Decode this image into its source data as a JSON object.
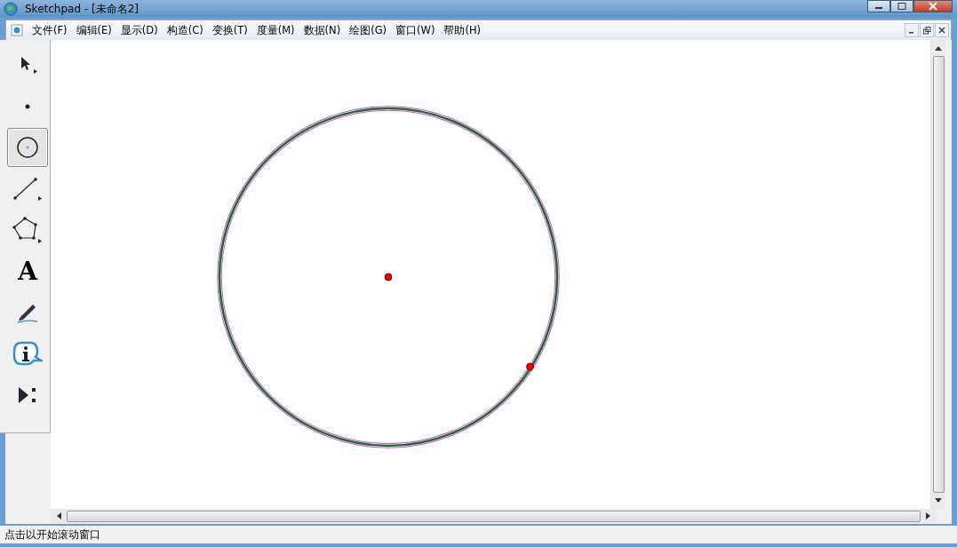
{
  "window": {
    "title": "Sketchpad  - [未命名2]"
  },
  "menu": [
    "文件(F)",
    "编辑(E)",
    "显示(D)",
    "构造(C)",
    "变换(T)",
    "度量(M)",
    "数据(N)",
    "绘图(G)",
    "窗口(W)",
    "帮助(H)"
  ],
  "tools": [
    {
      "kind": "arrow",
      "selected": false
    },
    {
      "kind": "point",
      "selected": false
    },
    {
      "kind": "compass",
      "selected": true
    },
    {
      "kind": "line",
      "selected": false
    },
    {
      "kind": "polygon",
      "selected": false
    },
    {
      "kind": "text",
      "label": "A",
      "selected": false
    },
    {
      "kind": "marker",
      "selected": false
    },
    {
      "kind": "info",
      "selected": false
    },
    {
      "kind": "custom",
      "selected": false
    }
  ],
  "circle": {
    "selected": true
  },
  "status_bar": "点击以开始滚动窗口"
}
